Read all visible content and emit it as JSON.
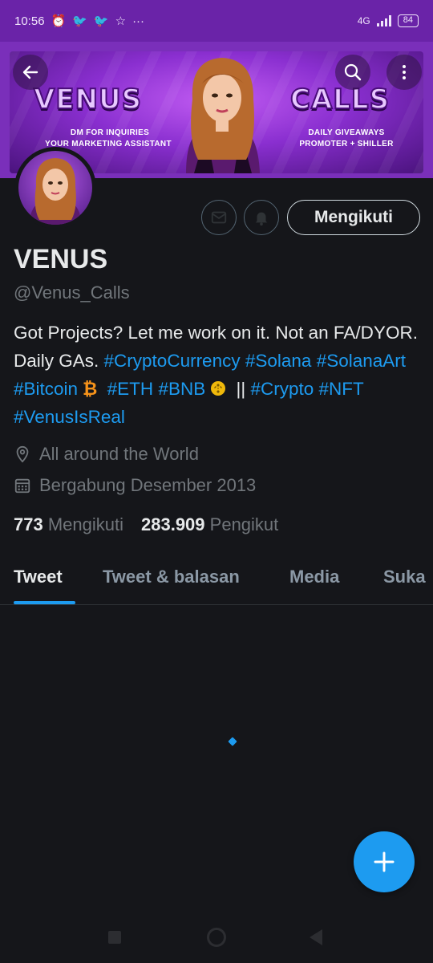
{
  "status_bar": {
    "time": "10:56",
    "network": "4G",
    "battery": "84"
  },
  "banner": {
    "left_title": "VENUS",
    "left_line1": "DM FOR INQUIRIES",
    "left_line2": "YOUR MARKETING ASSISTANT",
    "right_title": "CALLS",
    "right_line1": "DAILY GIVEAWAYS",
    "right_line2": "PROMOTER + SHILLER"
  },
  "actions": {
    "follow_label": "Mengikuti"
  },
  "profile": {
    "name": "VENUS",
    "handle": "@Venus_Calls",
    "bio": {
      "text1": "Got Projects? Let me work on it.  Not an FA/DYOR. Daily GAs. ",
      "tag_crypto_currency": "#CryptoCurrency",
      "tag_solana": "#Solana",
      "tag_solana_art": "#SolanaArt",
      "tag_bitcoin": "#Bitcoin",
      "btc_symbol": "₿",
      "tag_eth": "#ETH",
      "tag_bnb": "#BNB",
      "separator": "||",
      "tag_crypto": "#Crypto",
      "tag_nft": "#NFT",
      "tag_venus_is_real": "#VenusIsReal"
    },
    "location": "All around the World",
    "joined": "Bergabung Desember 2013",
    "following_count": "773",
    "following_label": "Mengikuti",
    "followers_count": "283.909",
    "followers_label": "Pengikut"
  },
  "tabs": [
    {
      "label": "Tweet",
      "active": true
    },
    {
      "label": "Tweet & balasan",
      "active": false
    },
    {
      "label": "Media",
      "active": false
    },
    {
      "label": "Suka",
      "active": false
    }
  ],
  "colors": {
    "accent": "#1d9bf0",
    "status_bar": "#6a23a8",
    "background": "#15161a"
  }
}
